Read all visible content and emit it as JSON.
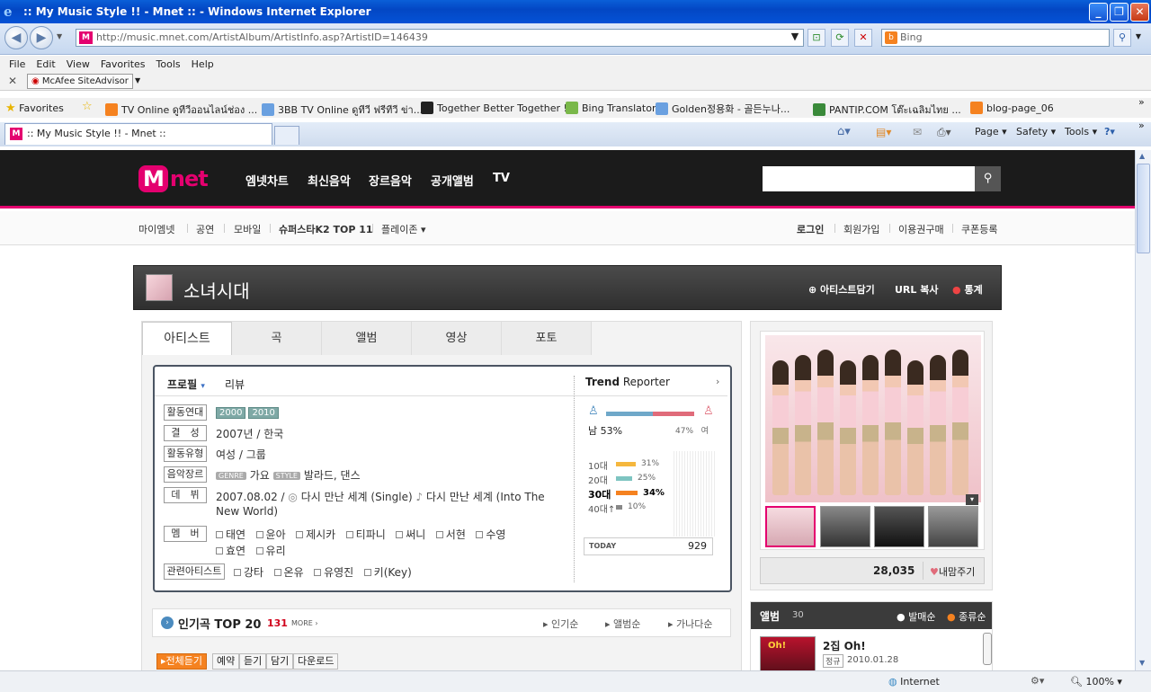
{
  "window": {
    "title": ":: My Music Style !! - Mnet :: - Windows Internet Explorer"
  },
  "address": {
    "url": "http://music.mnet.com/ArtistAlbum/ArtistInfo.asp?ArtistID=146439",
    "search_placeholder": "Bing"
  },
  "menu": [
    "File",
    "Edit",
    "View",
    "Favorites",
    "Tools",
    "Help"
  ],
  "mcafee": "McAfee SiteAdvisor",
  "favorites": {
    "label": "Favorites",
    "items": [
      "TV Online ดูทีวีออนไลน์ช่อง ...",
      "3BB TV Online ดูทีวี ฟรีทีวี ข่า...",
      "Together  Better Together !",
      "Bing Translator",
      "Golden정용화 - 골든누나...",
      "PANTIP.COM โต๊ะเฉลิมไทย ...",
      "blog-page_06"
    ]
  },
  "tab": {
    "title": ":: My Music Style !! - Mnet ::"
  },
  "commands": {
    "page": "Page",
    "safety": "Safety",
    "tools": "Tools"
  },
  "gnb": {
    "logo_m": "M",
    "logo_net": "net",
    "items": [
      "엠넷차트",
      "최신음악",
      "장르음악",
      "공개앨범",
      "TV"
    ]
  },
  "subnav": {
    "left": [
      "마이엠넷",
      "공연",
      "모바일",
      "슈퍼스타K2 TOP 11",
      "플레이존"
    ],
    "right": [
      "로그인",
      "회원가입",
      "이용권구매",
      "쿠폰등록"
    ]
  },
  "artist": {
    "name": "소녀시대",
    "actions": [
      "아티스트담기",
      "URL 복사",
      "통계"
    ]
  },
  "tabs": [
    "아티스트",
    "곡",
    "앨범",
    "영상",
    "포토"
  ],
  "profile": {
    "tabs": [
      "프로필",
      "리뷰"
    ],
    "rows": {
      "era_label": "활동연대",
      "era": [
        "2000",
        "2010"
      ],
      "formed_label": "결　성",
      "formed": "2007년 / 한국",
      "type_label": "활동유형",
      "type": "여성 / 그룹",
      "genre_label": "음악장르",
      "genre_tag": "GENRE",
      "genre": "가요",
      "style_tag": "STYLE",
      "style": "발라드, 댄스",
      "debut_label": "데　뷔",
      "debut_date": "2007.08.02 /",
      "debut_single": "다시 만난 세계 (Single)",
      "debut_album": "다시 만난 세계 (Into The",
      "debut_album2": "New World)",
      "members_label": "멤　버",
      "members": [
        "태연",
        "윤아",
        "제시카",
        "티파니",
        "써니",
        "서현",
        "수영",
        "효연",
        "유리"
      ],
      "related_label": "관련아티스트",
      "related": [
        "강타",
        "온유",
        "유영진",
        "키(Key)"
      ]
    }
  },
  "trend": {
    "title_bold": "Trend",
    "title_rest": " Reporter",
    "male_label": "남",
    "male_pct": "53%",
    "female_pct": "47%",
    "female_label": "여",
    "ages": [
      {
        "label": "10대",
        "pct": "31%",
        "value": 31
      },
      {
        "label": "20대",
        "pct": "25%",
        "value": 25
      },
      {
        "label": "30대",
        "pct": "34%",
        "value": 34
      },
      {
        "label": "40대↑",
        "pct": "10%",
        "value": 10
      }
    ],
    "today_label": "TODAY",
    "today_value": "929"
  },
  "likes": {
    "count": "28,035",
    "label": "내맘주기"
  },
  "top20": {
    "title": "인기곡 TOP 20",
    "count": "131",
    "more": "MORE",
    "sorts": [
      "인기순",
      "앨범순",
      "가나다순"
    ]
  },
  "album": {
    "title": "앨범",
    "count": "30",
    "filters": [
      "발매순",
      "종류순"
    ],
    "item_title": "2집 Oh!",
    "item_type": "정규",
    "item_date": "2010.01.28",
    "cover_text": "Oh!"
  },
  "buttons": [
    "전체듣기",
    "예약",
    "듣기",
    "담기",
    "다운로드"
  ],
  "status": {
    "zone": "Internet",
    "zoom": "100%"
  }
}
